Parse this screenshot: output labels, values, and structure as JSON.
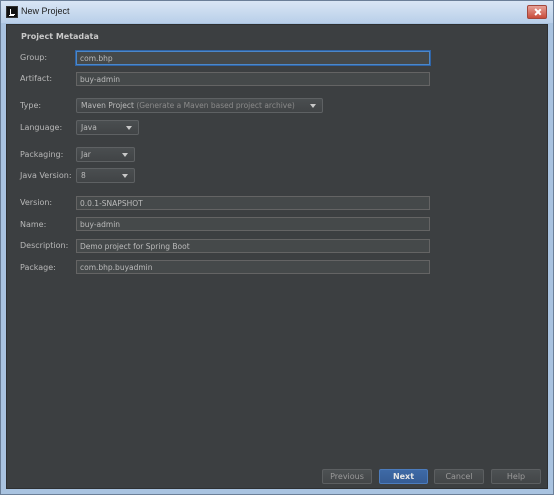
{
  "window": {
    "title": "New Project"
  },
  "section": {
    "title": "Project Metadata"
  },
  "fields": {
    "group": {
      "label": "Group:",
      "value": "com.bhp"
    },
    "artifact": {
      "label": "Artifact:",
      "value": "buy-admin"
    },
    "type": {
      "label": "Type:",
      "value": "Maven Project",
      "hint": "(Generate a Maven based project archive)"
    },
    "language": {
      "label": "Language:",
      "value": "Java"
    },
    "packaging": {
      "label": "Packaging:",
      "value": "Jar"
    },
    "java_version": {
      "label": "Java Version:",
      "value": "8"
    },
    "version": {
      "label": "Version:",
      "value": "0.0.1-SNAPSHOT"
    },
    "name": {
      "label": "Name:",
      "value": "buy-admin"
    },
    "description": {
      "label": "Description:",
      "value": "Demo project for Spring Boot"
    },
    "package": {
      "label": "Package:",
      "value": "com.bhp.buyadmin"
    }
  },
  "buttons": {
    "previous": "Previous",
    "next": "Next",
    "cancel": "Cancel",
    "help": "Help"
  },
  "icons": {
    "app": "intellij-app-icon",
    "close": "close-icon",
    "dropdown": "chevron-down-icon"
  },
  "colors": {
    "background": "#3c3f41",
    "input_background": "#45494a",
    "focus_border": "#4b87c9",
    "primary_button": "#365d95",
    "text": "#bbbbbb"
  }
}
